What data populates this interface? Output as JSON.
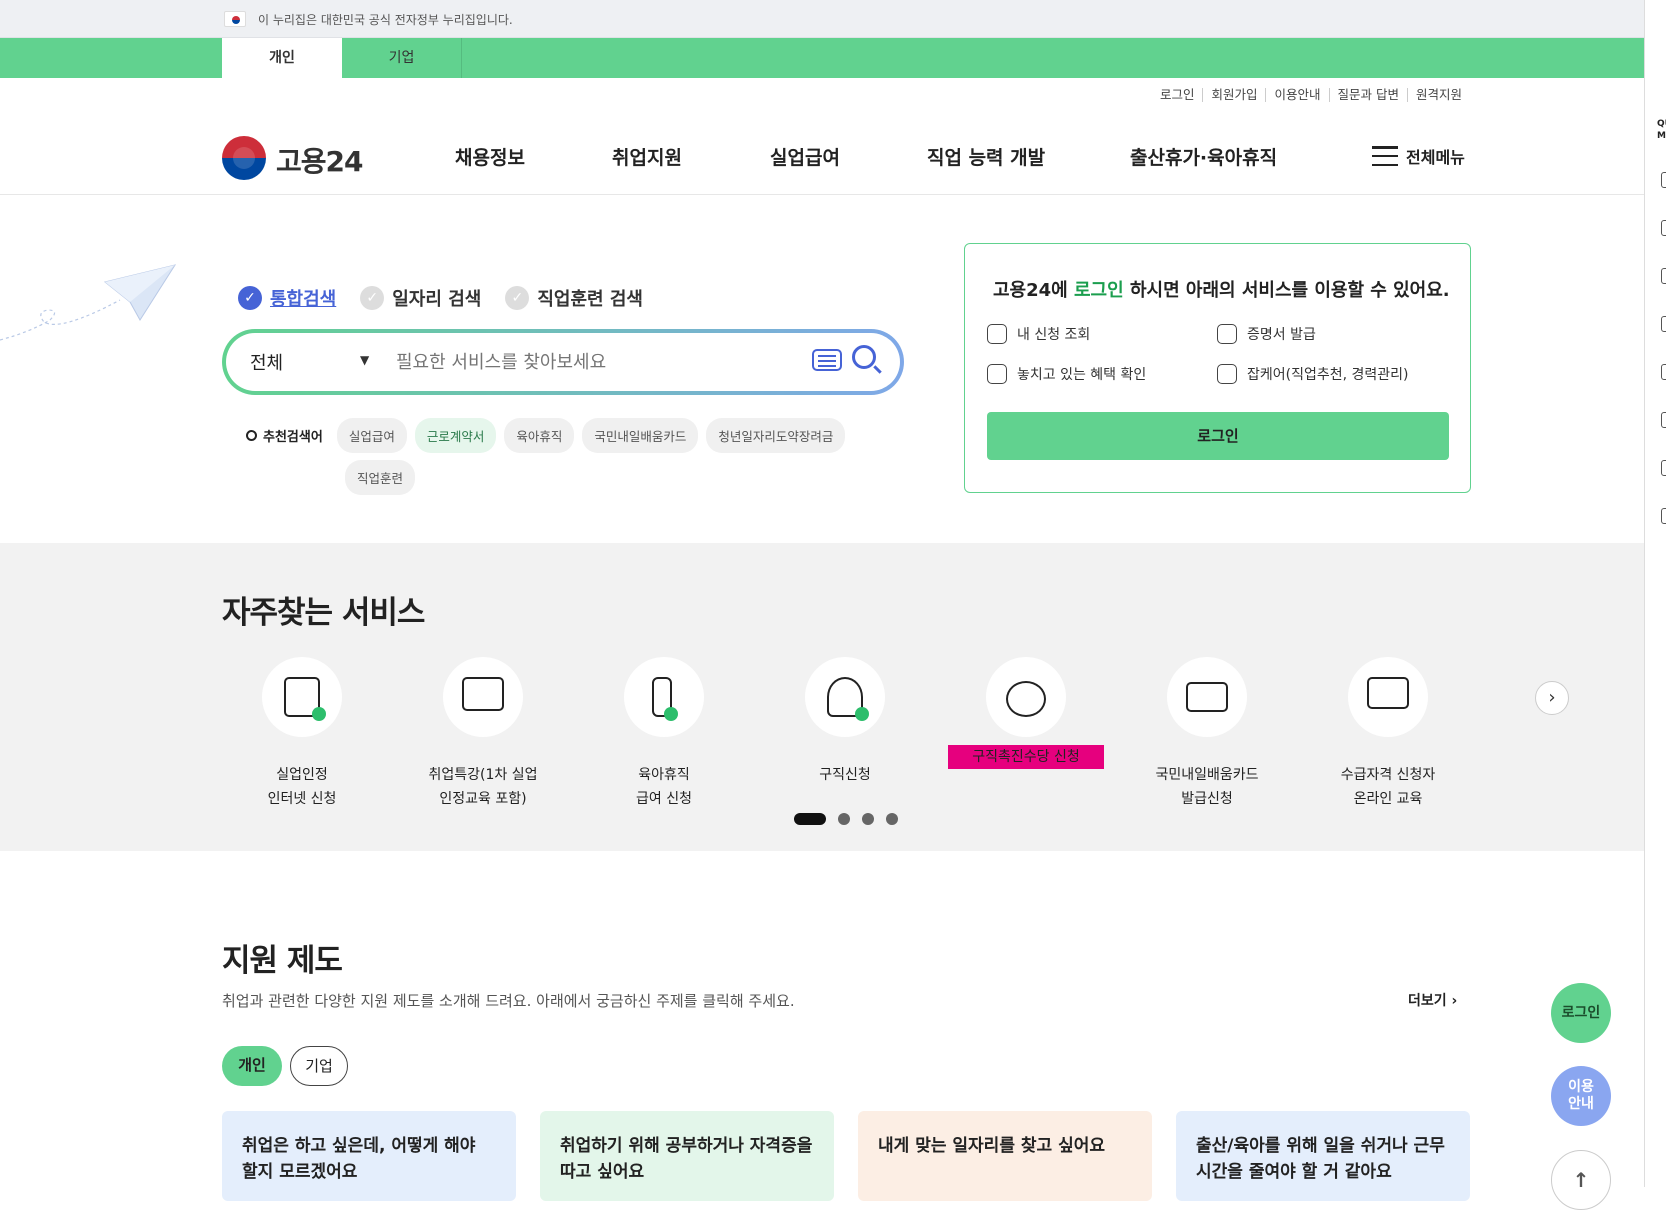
{
  "gov_banner": {
    "text": "이 누리집은 대한민국 공식 전자정부 누리집입니다."
  },
  "user_tabs": [
    "개인",
    "기업"
  ],
  "util_links": [
    "로그인",
    "회원가입",
    "이용안내",
    "질문과 답변",
    "원격지원"
  ],
  "logo": {
    "text": "고용24"
  },
  "gnb": [
    "채용정보",
    "취업지원",
    "실업급여",
    "직업 능력 개발",
    "출산휴가·육아휴직"
  ],
  "all_menu": "전체메뉴",
  "search": {
    "tabs": [
      "통합검색",
      "일자리 검색",
      "직업훈련 검색"
    ],
    "select_value": "전체",
    "placeholder": "필요한 서비스를 찾아보세요",
    "rec_label": "추천검색어",
    "keywords": [
      "실업급여",
      "근로계약서",
      "육아휴직",
      "국민내일배움카드",
      "청년일자리도약장려금",
      "직업훈련"
    ]
  },
  "login_box": {
    "title_pre": "고용24에 ",
    "title_em": "로그인",
    "title_post": " 하시면 아래의 서비스를 이용할 수 있어요.",
    "items": [
      "내 신청 조회",
      "증명서 발급",
      "놓치고 있는 혜택 확인",
      "잡케어(직업추천, 경력관리)"
    ],
    "button": "로그인"
  },
  "frequent": {
    "title": "자주찾는 서비스",
    "items": [
      {
        "l1": "실업인정",
        "l2": "인터넷 신청",
        "icon": "document-pen-icon"
      },
      {
        "l1": "취업특강(1차 실업",
        "l2": "인정교육 포함)",
        "icon": "presentation-board-icon"
      },
      {
        "l1": "육아휴직",
        "l2": "급여 신청",
        "icon": "baby-bottle-icon"
      },
      {
        "l1": "구직신청",
        "l2": "",
        "icon": "person-pen-icon"
      },
      {
        "l1": "구직촉진수당 신청",
        "l2": "",
        "icon": "money-bag-icon"
      },
      {
        "l1": "국민내일배움카드",
        "l2": "발급신청",
        "icon": "card-icon"
      },
      {
        "l1": "수급자격 신청자",
        "l2": "온라인 교육",
        "icon": "monitor-play-icon"
      }
    ]
  },
  "support": {
    "title": "지원 제도",
    "desc": "취업과 관련한 다양한 지원 제도를 소개해 드려요. 아래에서 궁금하신 주제를 클릭해 주세요.",
    "more": "더보기 ›",
    "pills": [
      "개인",
      "기업"
    ],
    "cards": [
      {
        "text": "취업은 하고 싶은데, 어떻게 해야 할지 모르겠어요",
        "color": "#e4eefc"
      },
      {
        "text": "취업하기 위해 공부하거나 자격증을 따고 싶어요",
        "color": "#e3f6ea"
      },
      {
        "text": "내게 맞는 일자리를 찾고 싶어요",
        "color": "#fceee4"
      },
      {
        "text": "출산/육아를 위해 일을 쉬거나 근무시간을 줄여야 할 거 같아요",
        "color": "#e4eefc"
      }
    ]
  },
  "floating": {
    "login": "로그인",
    "guide_1": "이용",
    "guide_2": "안내",
    "top": "↑"
  },
  "quick_menu": "QUICK MENU",
  "colors": {
    "accent": "#61d28f",
    "blue": "#4663d6",
    "highlight": "#e6007e"
  }
}
